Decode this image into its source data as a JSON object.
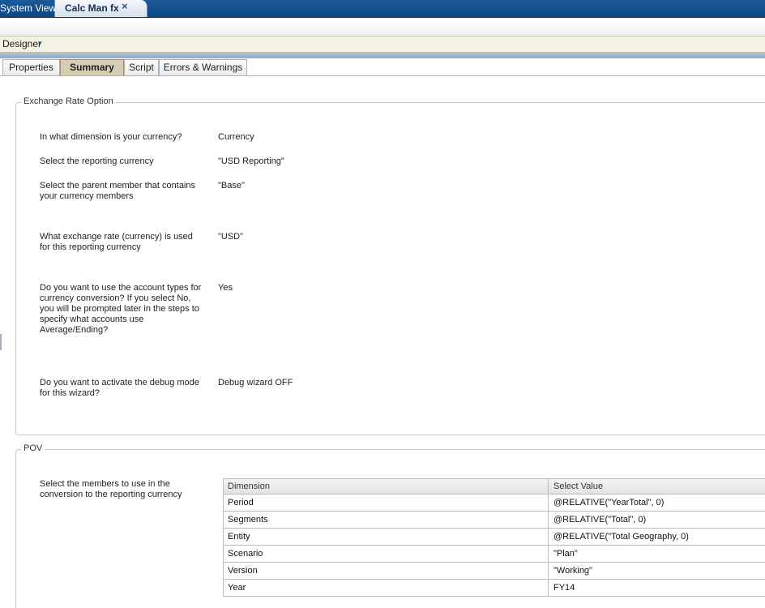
{
  "top_tabs": [
    {
      "label": "System View",
      "active": false
    },
    {
      "label": "Calc Man fx",
      "active": true
    }
  ],
  "close_symbol": "×",
  "designer": {
    "label": "Designer",
    "caret": "▾"
  },
  "tabs": [
    {
      "label": "Properties",
      "selected": false
    },
    {
      "label": "Summary",
      "selected": true
    },
    {
      "label": "Script",
      "selected": false
    },
    {
      "label": "Errors & Warnings",
      "selected": false
    }
  ],
  "exchange": {
    "title": "Exchange Rate Option",
    "rows": [
      {
        "question": "In what dimension is your currency?",
        "answer": "Currency"
      },
      {
        "question": "Select the reporting currency",
        "answer": "\"USD Reporting\""
      },
      {
        "question": "Select the parent member that contains your currency members",
        "answer": "\"Base\""
      },
      {
        "question": "What exchange rate (currency) is used for this reporting currency",
        "answer": "\"USD\""
      },
      {
        "question": "Do you want to use the account types for currency conversion? If you select No, you will be prompted later in the steps to specify what accounts use Average/Ending?",
        "answer": "Yes"
      },
      {
        "question": "Do you want to activate the debug mode for this wizard?",
        "answer": "Debug wizard OFF"
      }
    ]
  },
  "pov": {
    "title": "POV",
    "prompt": "Select the members to use in the conversion to the reporting currency",
    "columns": [
      "Dimension",
      "Select Value"
    ],
    "rows": [
      {
        "dimension": "Period",
        "value": "@RELATIVE(\"YearTotal\", 0)"
      },
      {
        "dimension": "Segments",
        "value": "@RELATIVE(\"Total\", 0)"
      },
      {
        "dimension": "Entity",
        "value": "@RELATIVE(\"Total Geography, 0)"
      },
      {
        "dimension": "Scenario",
        "value": "\"Plan\""
      },
      {
        "dimension": "Version",
        "value": "\"Working\""
      },
      {
        "dimension": "Year",
        "value": "FY14"
      }
    ]
  }
}
